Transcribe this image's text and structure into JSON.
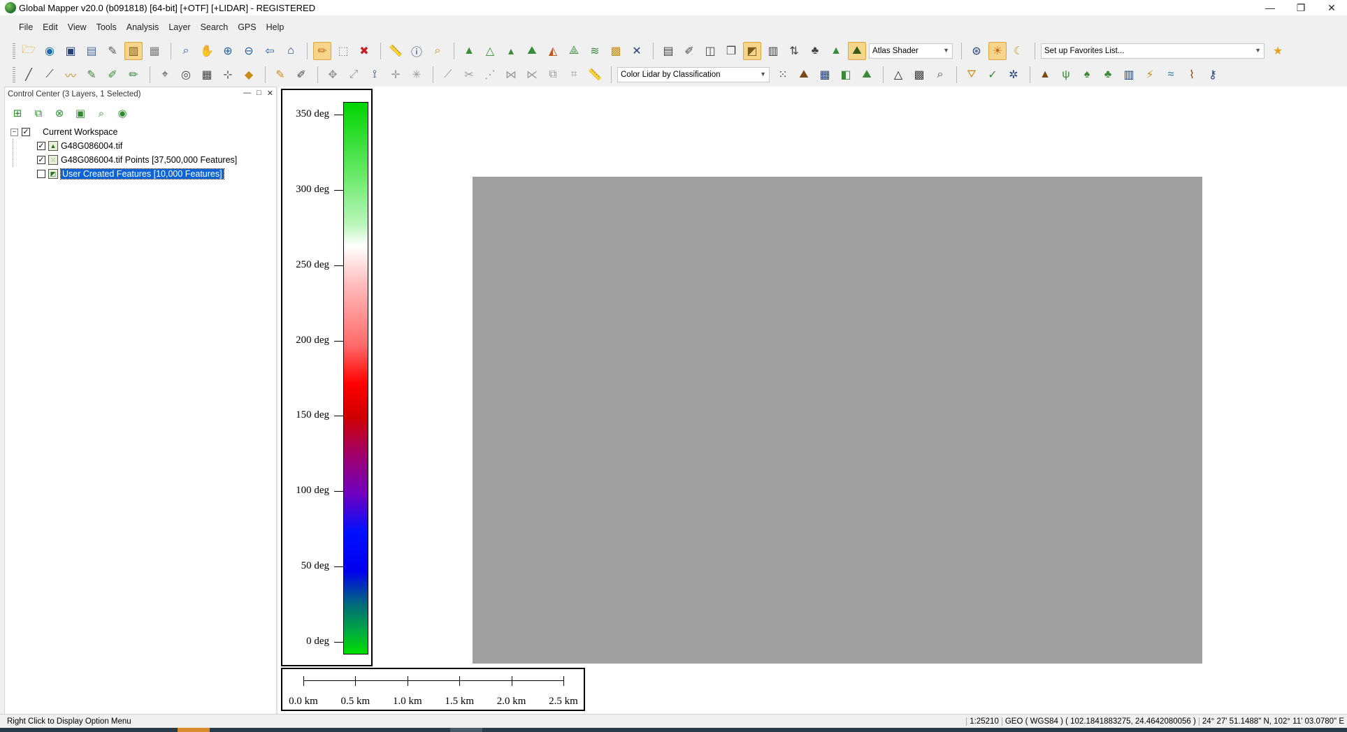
{
  "window": {
    "title": "Global Mapper v20.0 (b091818) [64-bit] [+OTF] [+LIDAR] - REGISTERED",
    "minimize_icon": "minimize-icon",
    "maximize_icon": "restore-icon",
    "close_icon": "close-icon"
  },
  "menu": [
    "File",
    "Edit",
    "View",
    "Tools",
    "Analysis",
    "Layer",
    "Search",
    "GPS",
    "Help"
  ],
  "toolbar": {
    "shader_combo": "Atlas Shader",
    "favorites_combo": "Set up Favorites List...",
    "lidar_combo": "Color Lidar by Classification"
  },
  "control_center": {
    "title": "Control Center (3 Layers, 1 Selected)",
    "root": "Current Workspace",
    "layers": [
      {
        "label": "G48G086004.tif",
        "checked": true,
        "selected": false,
        "icon": "raster-layer-icon"
      },
      {
        "label": "G48G086004.tif Points [37,500,000 Features]",
        "checked": true,
        "selected": false,
        "icon": "point-layer-icon"
      },
      {
        "label": "User Created Features [10,000 Features]",
        "checked": false,
        "selected": true,
        "icon": "vector-layer-icon"
      }
    ]
  },
  "legend": {
    "labels": [
      "350 deg",
      "300 deg",
      "250 deg",
      "200 deg",
      "150 deg",
      "100 deg",
      "50 deg",
      "0 deg"
    ],
    "values": [
      350,
      300,
      250,
      200,
      150,
      100,
      50,
      0
    ]
  },
  "scale_bar": {
    "labels": [
      "0.0 km",
      "0.5 km",
      "1.0 km",
      "1.5 km",
      "2.0 km",
      "2.5 km"
    ]
  },
  "status": {
    "hint": "Right Click to Display Option Menu",
    "scale": "1:25210",
    "projection": "GEO ( WGS84 ) ( 102.1841883275, 24.4642080056 )",
    "coords": "24° 27' 51.1488\" N, 102° 11' 03.0780\" E"
  },
  "colors": {
    "selection": "#0a64d8",
    "raster_gray": "#a0a0a0",
    "active_tool": "#f6d58a"
  }
}
